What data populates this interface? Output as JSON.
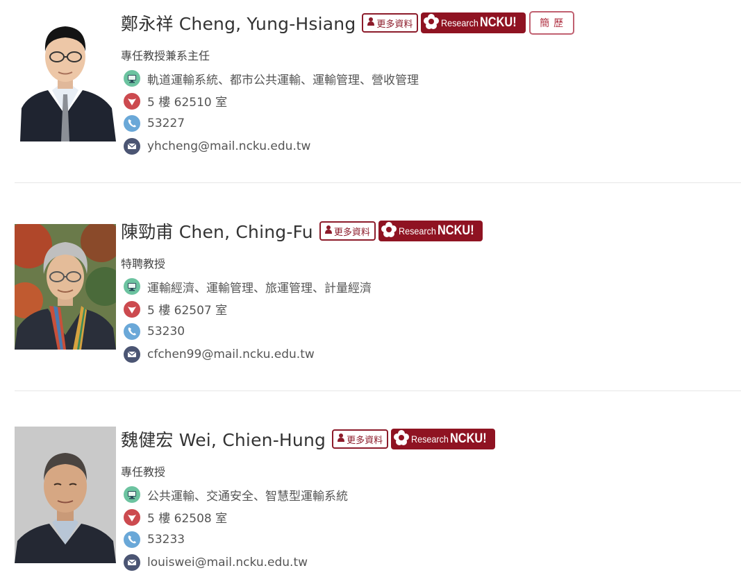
{
  "colors": {
    "brand": "#8f1322",
    "specialty_icon": "#6cc3a0",
    "office_icon": "#cc4a4f",
    "phone_icon": "#6aa8d8",
    "email_icon": "#4b5573"
  },
  "buttons": {
    "more_label": "更多資料",
    "research_small": "Research",
    "research_big": "NCKU!",
    "cv_label": "簡歷"
  },
  "icons": {
    "specialty": "monitor-icon",
    "office": "location-pin-icon",
    "phone": "phone-icon",
    "email": "envelope-icon",
    "more": "person-icon",
    "research": "ncku-flower-logo"
  },
  "members": [
    {
      "name": "鄭永祥 Cheng, Yung-Hsiang",
      "title": "專任教授兼系主任",
      "specialty": "軌道運輸系統、都市公共運輸、運輸管理、營收管理",
      "office": "5 樓 62510 室",
      "phone": "53227",
      "email": "yhcheng@mail.ncku.edu.tw",
      "has_cv": true
    },
    {
      "name": "陳勁甫 Chen, Ching-Fu",
      "title": "特聘教授",
      "specialty": "運輸經濟、運輸管理、旅運管理、計量經濟",
      "office": "5 樓 62507 室",
      "phone": "53230",
      "email": "cfchen99@mail.ncku.edu.tw",
      "has_cv": false
    },
    {
      "name": "魏健宏 Wei, Chien-Hung",
      "title": "專任教授",
      "specialty": "公共運輸、交通安全、智慧型運輸系統",
      "office": "5 樓 62508 室",
      "phone": "53233",
      "email": "louiswei@mail.ncku.edu.tw",
      "has_cv": false
    }
  ]
}
